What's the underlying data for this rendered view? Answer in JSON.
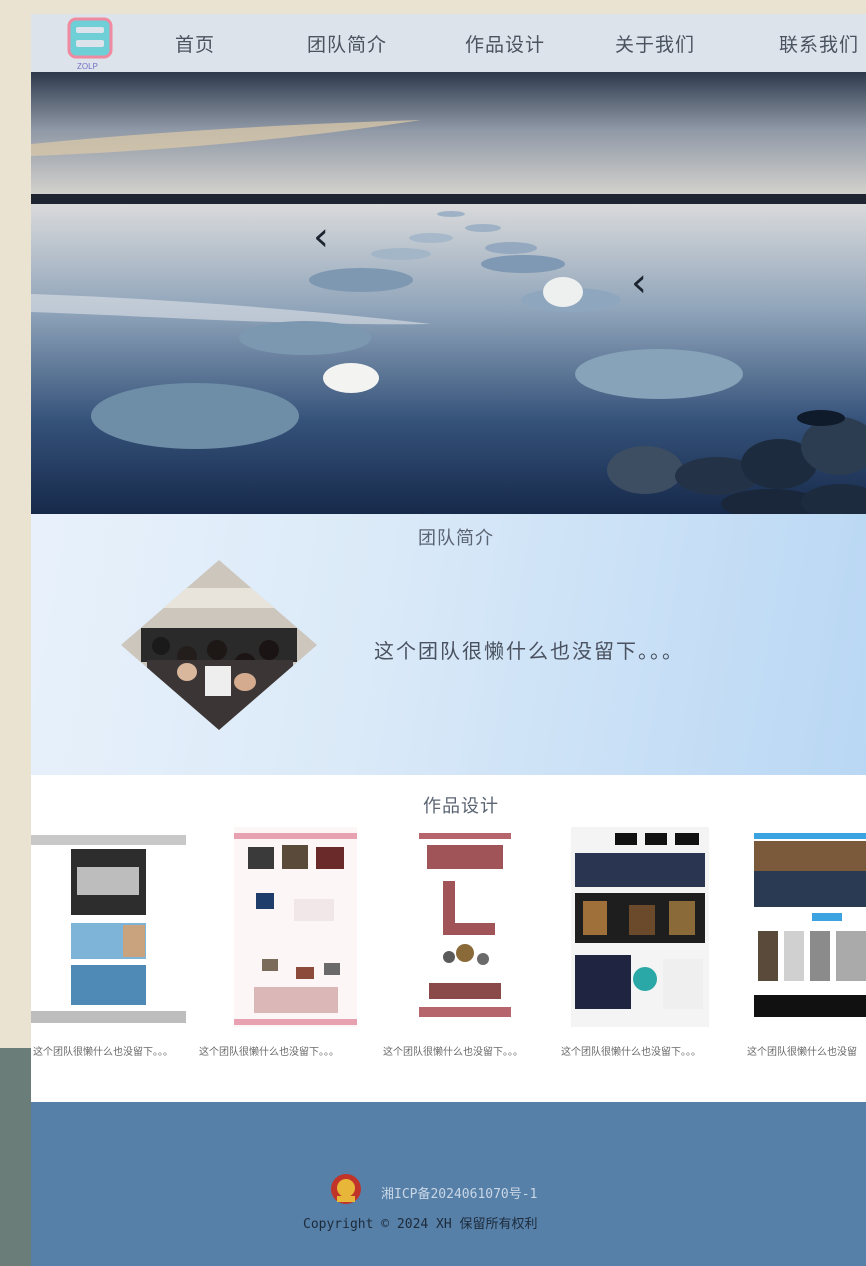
{
  "brand": {
    "logo_text": "ZOLP"
  },
  "nav": {
    "items": [
      {
        "label": "首页"
      },
      {
        "label": "团队简介"
      },
      {
        "label": "作品设计"
      },
      {
        "label": "关于我们"
      },
      {
        "label": "联系我们"
      }
    ]
  },
  "hero": {
    "prev_label": "‹",
    "next_label": "‹"
  },
  "about": {
    "title": "团队简介",
    "description": "这个团队很懒什么也没留下。。。"
  },
  "works": {
    "title": "作品设计",
    "items": [
      {
        "caption": "这个团队很懒什么也没留下。。。"
      },
      {
        "caption": "这个团队很懒什么也没留下。。。"
      },
      {
        "caption": "这个团队很懒什么也没留下。。。"
      },
      {
        "caption": "这个团队很懒什么也没留下。。。"
      },
      {
        "caption": "这个团队很懒什么也没留"
      }
    ]
  },
  "footer": {
    "icp": "湘ICP备2024061070号-1",
    "copyright": "Copyright © 2024 XH 保留所有权利"
  },
  "colors": {
    "nav_bg": "#dde3ea",
    "footer_bg": "#5680a8",
    "page_bg": "#ebe3d2",
    "about_gradient_end": "#b9d7f4"
  }
}
